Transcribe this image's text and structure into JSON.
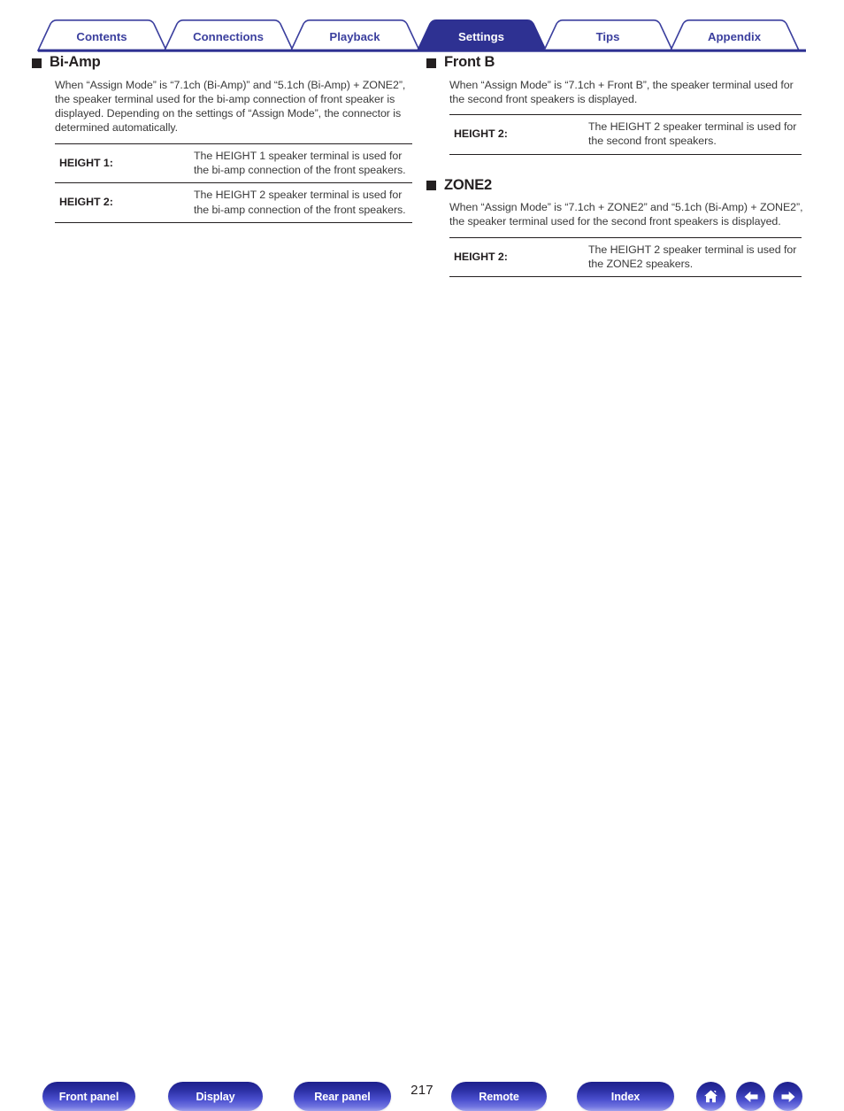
{
  "tabs": [
    {
      "label": "Contents",
      "active": false
    },
    {
      "label": "Connections",
      "active": false
    },
    {
      "label": "Playback",
      "active": false
    },
    {
      "label": "Settings",
      "active": true
    },
    {
      "label": "Tips",
      "active": false
    },
    {
      "label": "Appendix",
      "active": false
    }
  ],
  "colors": {
    "tab_blue": "#3b3f9e",
    "tab_active_fill": "#2e3192",
    "button_blue": "#2b2fa3",
    "rule_black": "#231f20"
  },
  "left_column": {
    "sections": [
      {
        "title": "Bi-Amp",
        "body": "When “Assign Mode” is “7.1ch (Bi-Amp)” and “5.1ch (Bi-Amp) + ZONE2”, the speaker terminal used for the bi-amp connection of front speaker is displayed. Depending on the settings of “Assign Mode”, the connector is determined automatically.",
        "rows": [
          {
            "term": "HEIGHT 1:",
            "desc": "The HEIGHT 1 speaker terminal is used for the bi-amp connection of the front speakers."
          },
          {
            "term": "HEIGHT 2:",
            "desc": "The HEIGHT 2 speaker terminal is used for the bi-amp connection of the front speakers."
          }
        ]
      }
    ]
  },
  "right_column": {
    "sections": [
      {
        "title": "Front B",
        "body": "When “Assign Mode” is “7.1ch + Front B”, the speaker terminal used for the second front speakers is displayed.",
        "rows": [
          {
            "term": "HEIGHT 2:",
            "desc": "The HEIGHT 2 speaker terminal is used for the second front speakers."
          }
        ]
      },
      {
        "title": "ZONE2",
        "body": "When “Assign Mode” is “7.1ch + ZONE2” and “5.1ch (Bi-Amp) + ZONE2”, the speaker terminal used for the second front speakers is displayed.",
        "rows": [
          {
            "term": "HEIGHT 2:",
            "desc": "The HEIGHT 2 speaker terminal is used for the ZONE2 speakers."
          }
        ]
      }
    ]
  },
  "footer": {
    "buttons": [
      {
        "label": "Front panel"
      },
      {
        "label": "Display"
      },
      {
        "label": "Rear panel"
      },
      {
        "label": "Remote"
      },
      {
        "label": "Index"
      }
    ],
    "page_number": "217",
    "icons": [
      {
        "name": "home-icon"
      },
      {
        "name": "arrow-left-icon"
      },
      {
        "name": "arrow-right-icon"
      }
    ]
  }
}
